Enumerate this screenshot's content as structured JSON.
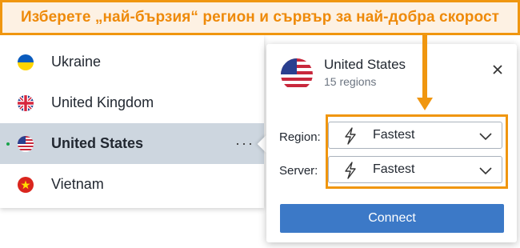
{
  "banner": {
    "text": "Изберете „най-бързия“ регион и сървър за най-добра скорост"
  },
  "countries": [
    {
      "name": "Ukraine",
      "flag": "ukraine-flag"
    },
    {
      "name": "United Kingdom",
      "flag": "uk-flag"
    },
    {
      "name": "United States",
      "flag": "us-flag",
      "selected": true,
      "connected_indicator": true
    },
    {
      "name": "Vietnam",
      "flag": "vietnam-flag"
    }
  ],
  "more_label": "···",
  "panel": {
    "title": "United States",
    "subtitle": "15 regions",
    "region_label": "Region:",
    "region_value": "Fastest",
    "server_label": "Server:",
    "server_value": "Fastest",
    "connect_label": "Connect"
  },
  "colors": {
    "accent_orange": "#f0960f",
    "connect_blue": "#3c79c7",
    "selected_row": "#cdd6df"
  }
}
